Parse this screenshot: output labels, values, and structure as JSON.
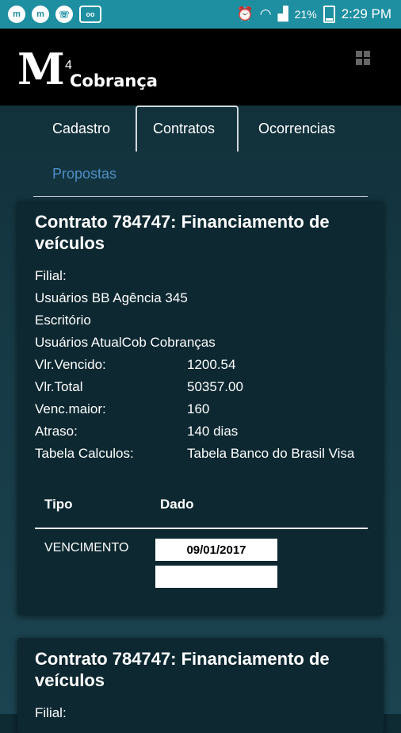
{
  "status_bar": {
    "left_icons": [
      "messenger-icon",
      "messenger-icon",
      "whatsapp-icon",
      "voicemail-icon"
    ],
    "battery": "21%",
    "time": "2:29 PM"
  },
  "app": {
    "logo_number": "4",
    "logo_text": "Cobrança"
  },
  "tabs": [
    {
      "label": "Cadastro",
      "active": false
    },
    {
      "label": "Contratos",
      "active": true
    },
    {
      "label": "Ocorrencias",
      "active": false
    },
    {
      "label": "Propostas",
      "active": false
    }
  ],
  "cards": [
    {
      "title": "Contrato 784747: Financiamento de veículos",
      "filial_label": "Filial:",
      "filial_value": "Usuários BB Agência 345",
      "escritorio_label": "Escritório",
      "escritorio_value": "Usuários AtualCob Cobranças",
      "fields": [
        {
          "label": "Vlr.Vencido:",
          "value": "1200.54"
        },
        {
          "label": "Vlr.Total",
          "value": "50357.00"
        },
        {
          "label": "Venc.maior:",
          "value": "160"
        },
        {
          "label": "Atraso:",
          "value": "140 dias"
        },
        {
          "label": "Tabela Calculos:",
          "value": "Tabela Banco do Brasil Visa"
        }
      ],
      "table": {
        "headers": [
          "Tipo",
          "Dado"
        ],
        "rows": [
          {
            "tipo": "VENCIMENTO",
            "dado": "09/01/2017"
          },
          {
            "tipo": "",
            "dado": ""
          }
        ]
      }
    },
    {
      "title": "Contrato 784747: Financiamento de veículos",
      "filial_label": "Filial:"
    }
  ]
}
